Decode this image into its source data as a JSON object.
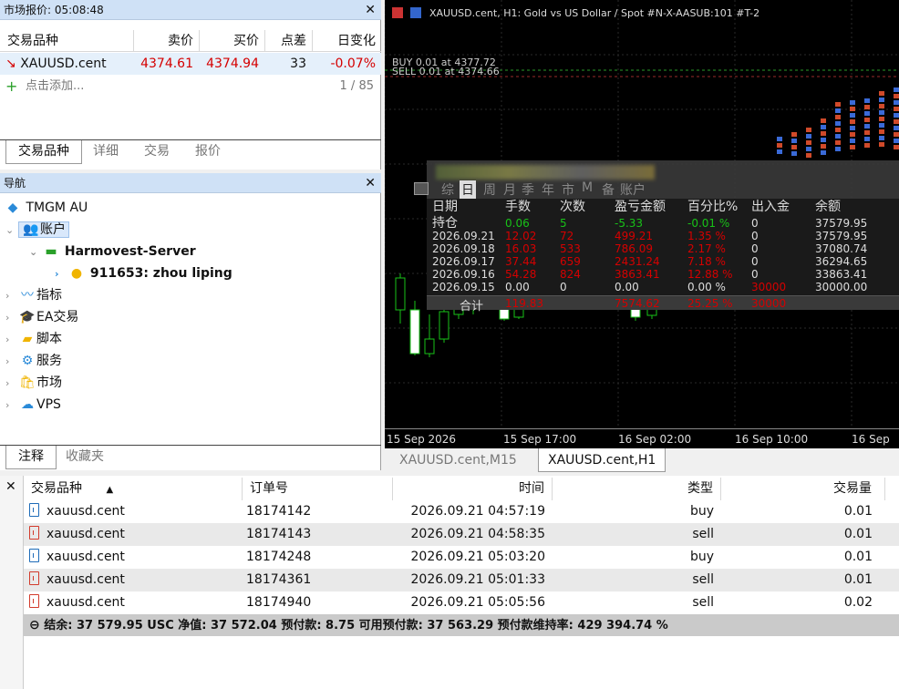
{
  "market_watch": {
    "title": "市场报价: 05:08:48",
    "headers": [
      "交易品种",
      "卖价",
      "买价",
      "点差",
      "日变化"
    ],
    "row": {
      "symbol": "XAUUSD.cent",
      "bid": "4374.61",
      "ask": "4374.94",
      "spread": "33",
      "change": "-0.07%"
    },
    "add_label": "点击添加...",
    "count": "1 / 85",
    "tabs": [
      "交易品种",
      "详细",
      "交易",
      "报价"
    ]
  },
  "navigator": {
    "title": "导航",
    "broker": "TMGM AU",
    "accounts_label": "账户",
    "server": "Harmovest-Server",
    "account": "911653: zhou liping",
    "items": [
      "指标",
      "EA交易",
      "脚本",
      "服务",
      "市场",
      "VPS"
    ],
    "tabs": [
      "注释",
      "收藏夹"
    ]
  },
  "chart": {
    "title": "XAUUSD.cent, H1:  Gold vs US Dollar / Spot #N-X-AASUB:101 #T-2",
    "trade_lines": [
      "BUY 0.01 at 4377.72",
      "SELL 0.01 at 4374.66"
    ],
    "time_labels": [
      "15 Sep 2026",
      "15 Sep 17:00",
      "16 Sep 02:00",
      "16 Sep 10:00",
      "16 Sep"
    ],
    "tabs": [
      "XAUUSD.cent,M15",
      "XAUUSD.cent,H1"
    ],
    "colors": {
      "bull": "#18c218",
      "bear": "#ffffff",
      "grid": "#2a2a2a"
    }
  },
  "stats_panel": {
    "periods": [
      "综",
      "日",
      "周",
      "月",
      "季",
      "年",
      "市",
      "M",
      "备",
      "账户"
    ],
    "headers": [
      "日期",
      "手数",
      "次数",
      "盈亏金额",
      "百分比%",
      "出入金",
      "余额"
    ],
    "rows": [
      {
        "date": "持仓",
        "lots": "0.06",
        "count": "5",
        "pnl": "-5.33",
        "pct": "-0.01 %",
        "flow": "0",
        "balance": "37579.95",
        "color": "g"
      },
      {
        "date": "2026.09.21",
        "lots": "12.02",
        "count": "72",
        "pnl": "499.21",
        "pct": "1.35 %",
        "flow": "0",
        "balance": "37579.95",
        "color": "r"
      },
      {
        "date": "2026.09.18",
        "lots": "16.03",
        "count": "533",
        "pnl": "786.09",
        "pct": "2.17 %",
        "flow": "0",
        "balance": "37080.74",
        "color": "r"
      },
      {
        "date": "2026.09.17",
        "lots": "37.44",
        "count": "659",
        "pnl": "2431.24",
        "pct": "7.18 %",
        "flow": "0",
        "balance": "36294.65",
        "color": "r"
      },
      {
        "date": "2026.09.16",
        "lots": "54.28",
        "count": "824",
        "pnl": "3863.41",
        "pct": "12.88 %",
        "flow": "0",
        "balance": "33863.41",
        "color": "r"
      },
      {
        "date": "2026.09.15",
        "lots": "0.00",
        "count": "0",
        "pnl": "0.00",
        "pct": "0.00 %",
        "flow": "30000",
        "balance": "30000.00",
        "color": "w"
      }
    ],
    "total": {
      "label": "合计",
      "lots": "119.83",
      "pnl": "7574.62",
      "pct": "25.25 %",
      "flow": "30000"
    }
  },
  "toolbox": {
    "headers": [
      "交易品种",
      "订单号",
      "时间",
      "类型",
      "交易量"
    ],
    "orders": [
      {
        "symbol": "xauusd.cent",
        "ticket": "18174142",
        "time": "2026.09.21 04:57:19",
        "type": "buy",
        "volume": "0.01"
      },
      {
        "symbol": "xauusd.cent",
        "ticket": "18174143",
        "time": "2026.09.21 04:58:35",
        "type": "sell",
        "volume": "0.01"
      },
      {
        "symbol": "xauusd.cent",
        "ticket": "18174248",
        "time": "2026.09.21 05:03:20",
        "type": "buy",
        "volume": "0.01"
      },
      {
        "symbol": "xauusd.cent",
        "ticket": "18174361",
        "time": "2026.09.21 05:01:33",
        "type": "sell",
        "volume": "0.01"
      },
      {
        "symbol": "xauusd.cent",
        "ticket": "18174940",
        "time": "2026.09.21 05:05:56",
        "type": "sell",
        "volume": "0.02"
      }
    ],
    "footer": "结余: 37 579.95 USC  净值: 37 572.04  预付款: 8.75  可用预付款: 37 563.29  预付款维持率: 429 394.74 %"
  }
}
